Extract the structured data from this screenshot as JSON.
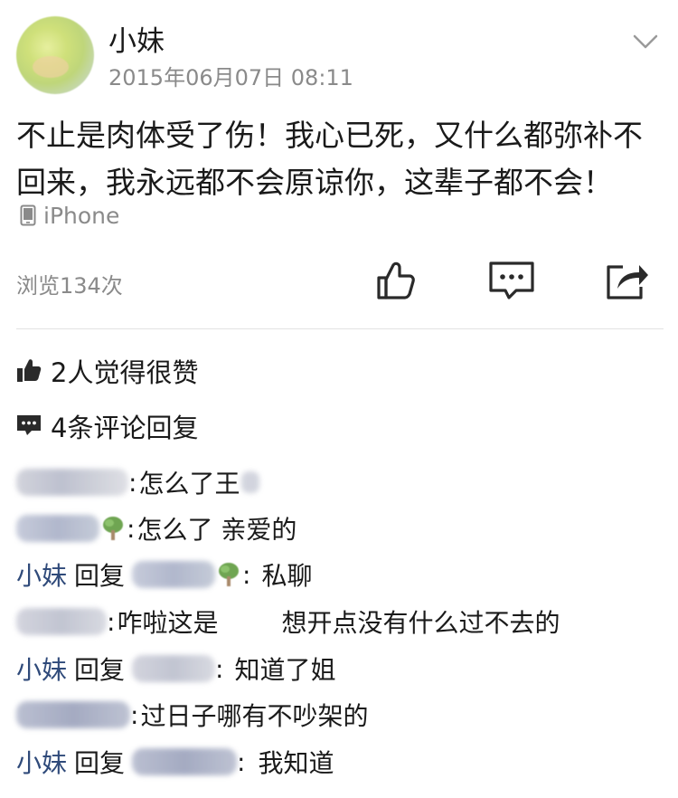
{
  "post": {
    "author": "小妹",
    "time": "2015年06月07日 08:11",
    "content": "不止是肉体受了伤！我心已死，又什么都弥补不回来，我永远都不会原谅你，这辈子都不会！",
    "device": "iPhone",
    "views": "浏览134次"
  },
  "stats": {
    "likes": "2人觉得很赞",
    "comments": "4条评论回复"
  },
  "comments": [
    {
      "text": "怎么了王"
    },
    {
      "text": "怎么了 亲爱的"
    },
    {
      "author": "小妹",
      "reply_word": "回复",
      "text": "私聊"
    },
    {
      "text_a": "咋啦这是",
      "text_b": "想开点没有什么过不去的"
    },
    {
      "author": "小妹",
      "reply_word": "回复",
      "text": "知道了姐"
    },
    {
      "text": "过日子哪有不吵架的"
    },
    {
      "author": "小妹",
      "reply_word": "回复",
      "text": "我知道"
    }
  ],
  "icons": {
    "chevron": "chevron-down-icon",
    "device": "phone-icon",
    "like": "thumbs-up-icon",
    "comment": "comment-bubble-icon",
    "share": "share-icon",
    "stat_like": "thumbs-up-filled-icon",
    "stat_comment": "comment-filled-icon",
    "emoji": "tree-emoji-icon"
  },
  "colors": {
    "name_link": "#2f4a7a",
    "secondary_text": "#8a8a8a",
    "icon_dark": "#2a2a2a"
  }
}
